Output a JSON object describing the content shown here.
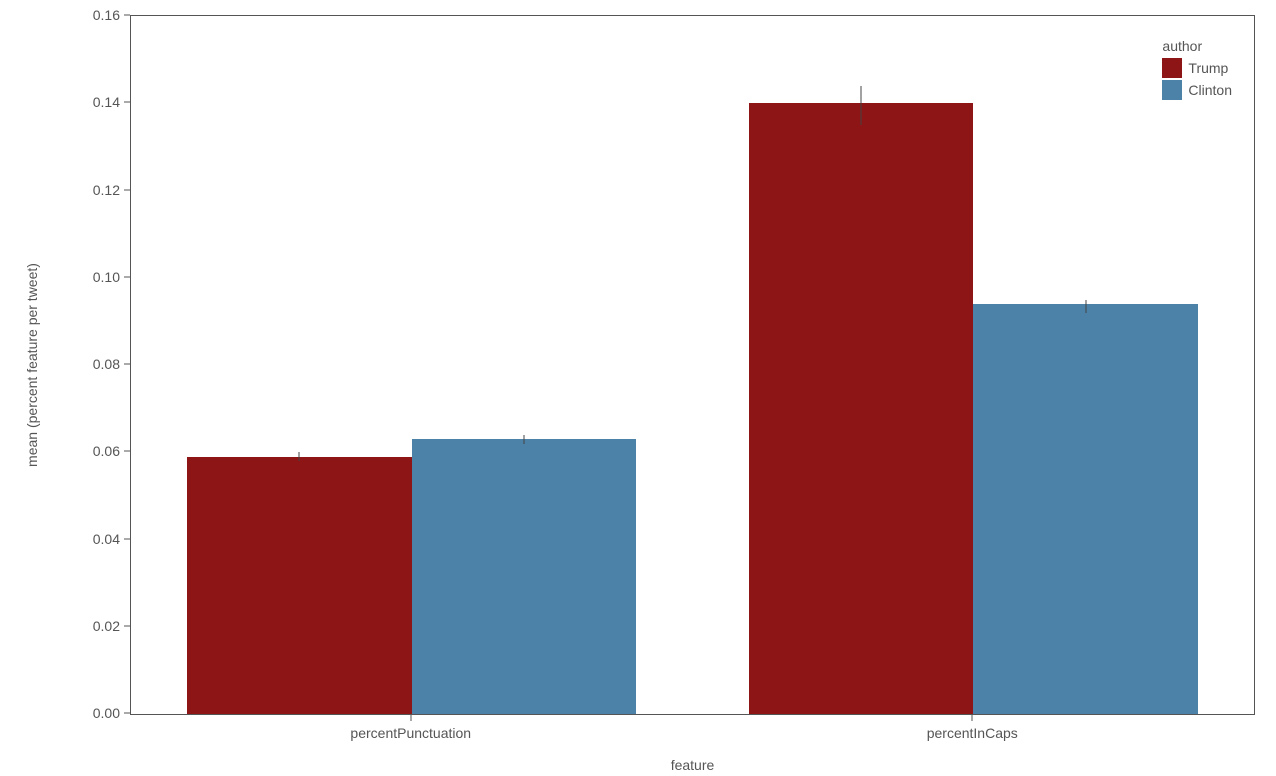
{
  "chart_data": {
    "type": "bar",
    "categories": [
      "percentPunctuation",
      "percentInCaps"
    ],
    "series": [
      {
        "name": "Trump",
        "values": [
          0.059,
          0.14
        ],
        "err_low": [
          0.058,
          0.135
        ],
        "err_high": [
          0.06,
          0.144
        ],
        "color": "#8e1515"
      },
      {
        "name": "Clinton",
        "values": [
          0.063,
          0.094
        ],
        "err_low": [
          0.062,
          0.092
        ],
        "err_high": [
          0.064,
          0.095
        ],
        "color": "#4c82a7"
      }
    ],
    "xlabel": "feature",
    "ylabel": "mean (percent feature per tweet)",
    "legend_title": "author",
    "ylim": [
      0.0,
      0.16
    ],
    "yticks": [
      "0.00",
      "0.02",
      "0.04",
      "0.06",
      "0.08",
      "0.10",
      "0.12",
      "0.14",
      "0.16"
    ]
  }
}
